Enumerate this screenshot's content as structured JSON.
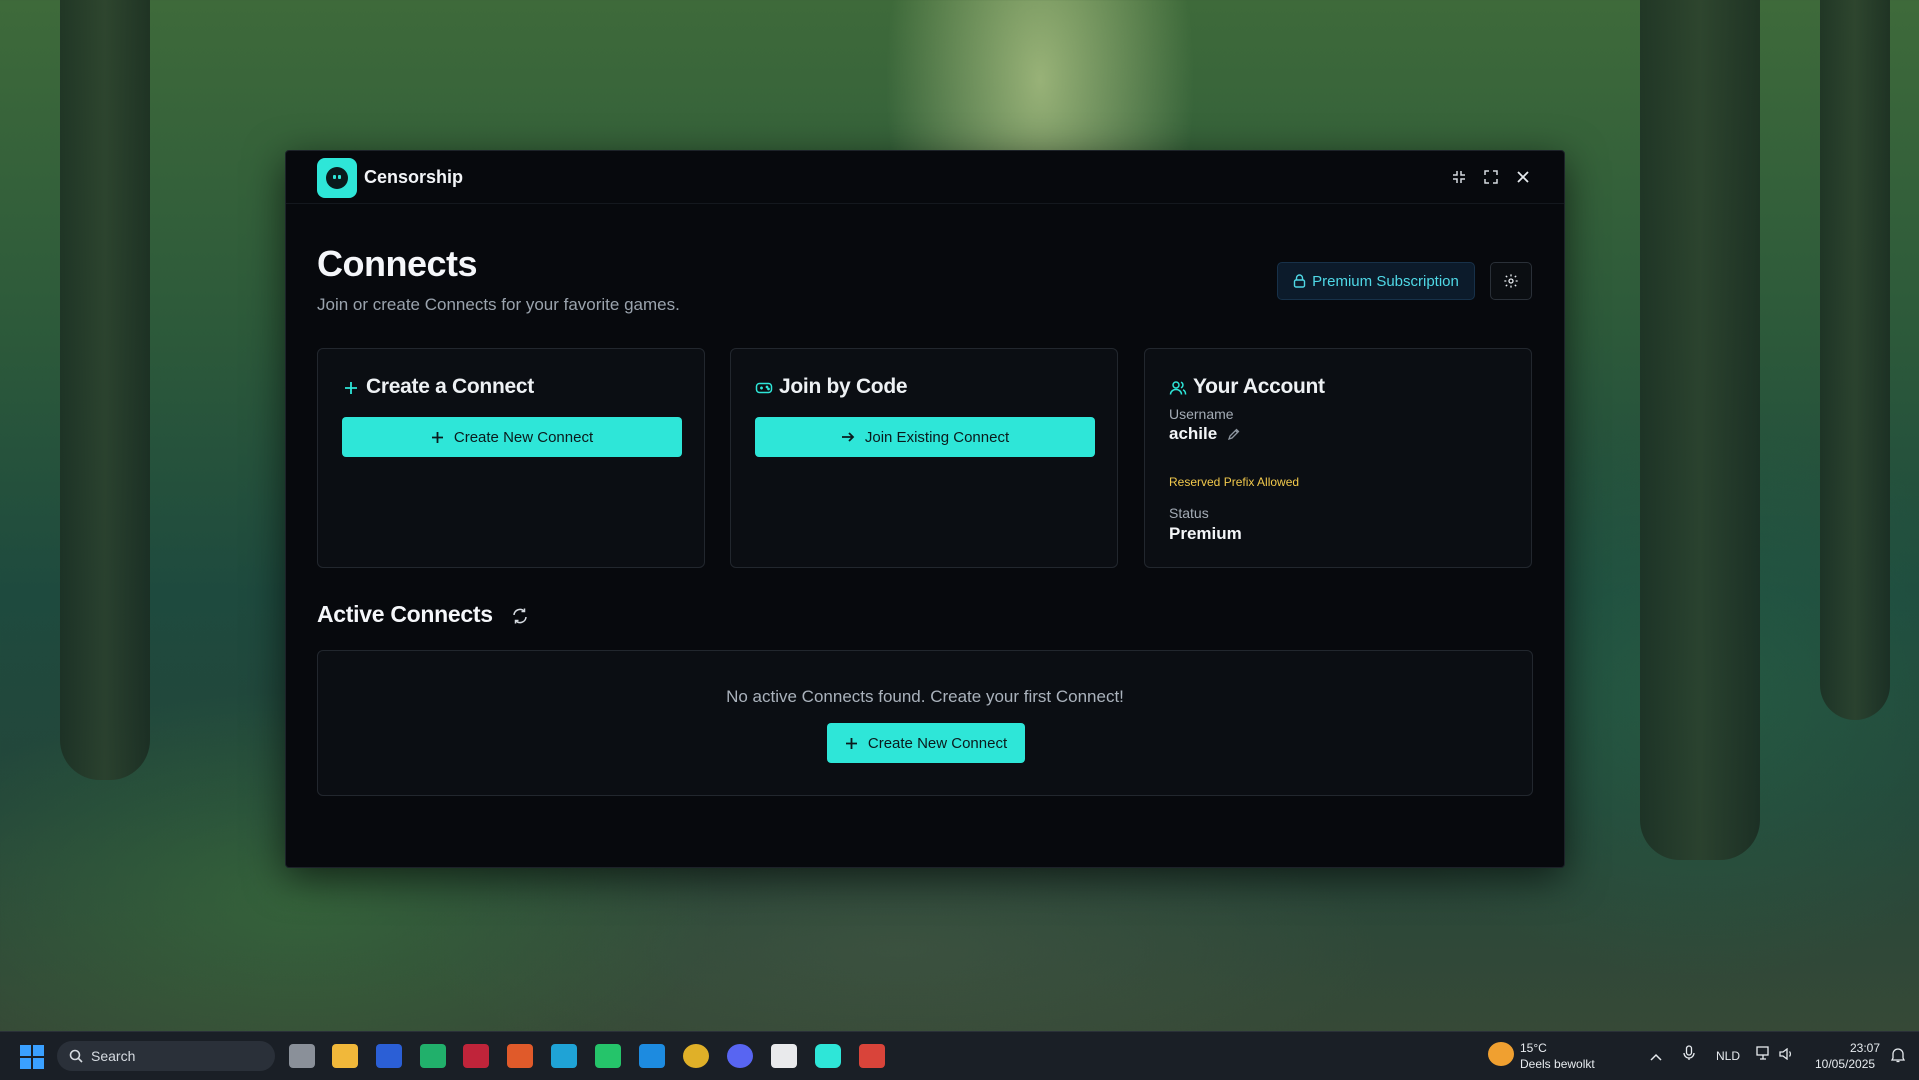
{
  "window": {
    "app_title": "Censorship",
    "controls": [
      "minimize-icon",
      "maximize-icon",
      "close-icon"
    ]
  },
  "header": {
    "title": "Connects",
    "subtitle": "Join or create Connects for your favorite games.",
    "premium_label": "Premium Subscription"
  },
  "cards": {
    "create": {
      "title": "Create a Connect",
      "button": "Create New Connect"
    },
    "join": {
      "title": "Join by Code",
      "button": "Join Existing Connect"
    },
    "account": {
      "title": "Your Account",
      "username_label": "Username",
      "username": "achile",
      "prefix_note": "Reserved Prefix Allowed",
      "status_label": "Status",
      "status": "Premium"
    }
  },
  "active": {
    "title": "Active Connects",
    "empty_text": "No active Connects found. Create your first Connect!",
    "empty_button": "Create New Connect"
  },
  "taskbar": {
    "search_placeholder": "Search",
    "weather_temp": "15°C",
    "weather_desc": "Deels bewolkt",
    "language": "NLD",
    "time": "23:07",
    "date": "10/05/2025"
  },
  "colors": {
    "accent": "#2ee6d8",
    "warning": "#f2c94c",
    "window_bg": "#07090d"
  }
}
